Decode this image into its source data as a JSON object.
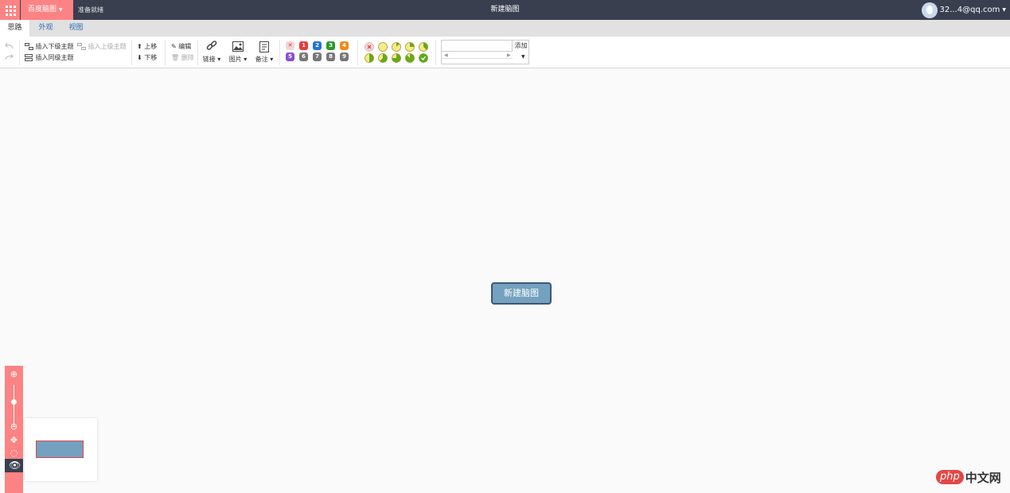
{
  "topbar": {
    "brand": "百度脑图",
    "status": "准备就绪",
    "title": "新建脑图",
    "user": "32...4@qq.com"
  },
  "tabs": [
    "思路",
    "外观",
    "视图"
  ],
  "toolbar": {
    "insert_child": "插入下级主题",
    "insert_parent": "插入上级主题",
    "insert_sibling": "插入同级主题",
    "move_up": "上移",
    "move_down": "下移",
    "edit": "编辑",
    "delete": "删除",
    "link": "链接",
    "image": "图片",
    "note": "备注",
    "priorities": [
      "1",
      "2",
      "3",
      "4",
      "5",
      "6",
      "7",
      "8",
      "9"
    ],
    "priority_colors": [
      "#e63b3b",
      "#2473d9",
      "#2a9a2a",
      "#f08a1c",
      "#8a4fd1",
      "#777777",
      "#777777",
      "#777777",
      "#777777"
    ],
    "progress_levels": [
      0,
      0,
      0.125,
      0.25,
      0.375,
      0.5,
      0.625,
      0.75,
      0.875,
      1
    ],
    "tag_add": "添加"
  },
  "canvas": {
    "root_topic": "新建脑图"
  },
  "zoom": {
    "level": 0.6
  },
  "watermark": {
    "php": "php",
    "cn": "中文网"
  },
  "colors": {
    "accent": "#fc8383",
    "topbar": "#393f4f",
    "root_fill": "#73a1bf",
    "root_border": "#3c5776"
  }
}
